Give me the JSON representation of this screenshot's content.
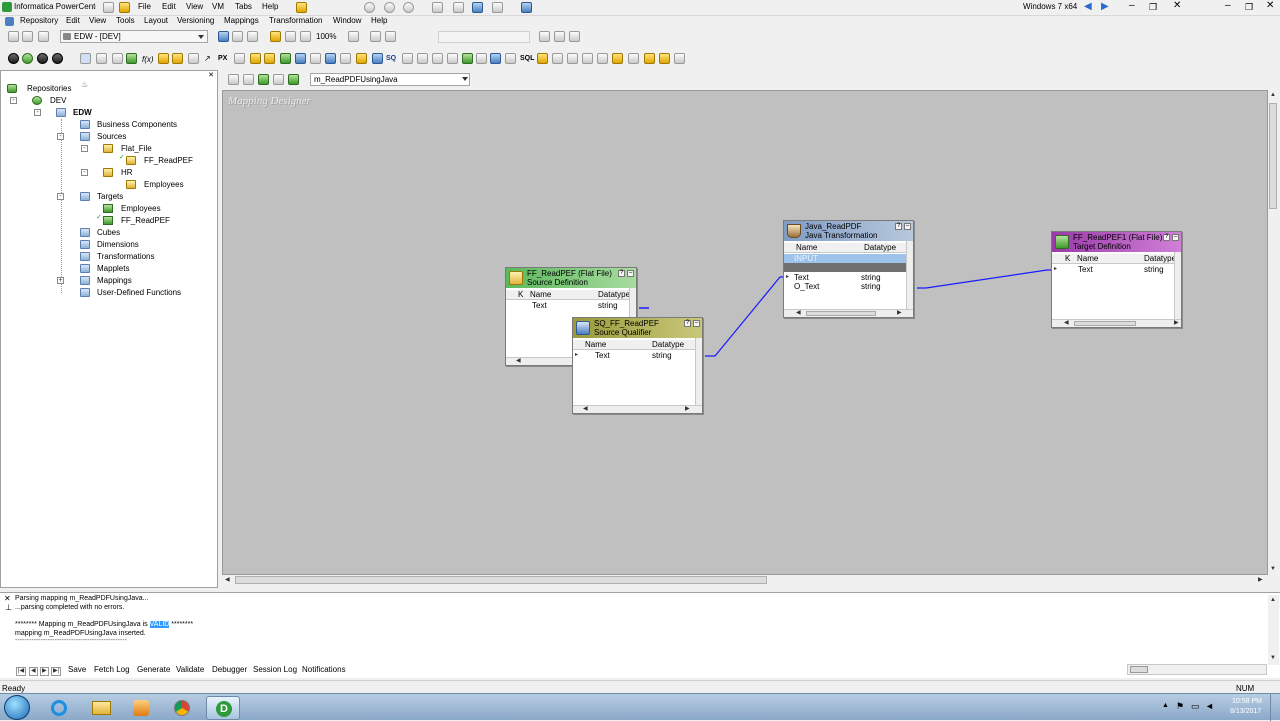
{
  "vm_bar": {
    "app_title": "Informatica PowerCenter",
    "menus": [
      "File",
      "Edit",
      "View",
      "VM",
      "Tabs",
      "Help"
    ],
    "guest_os": "Windows 7 x64"
  },
  "menubar": {
    "items": [
      "Repository",
      "Edit",
      "View",
      "Tools",
      "Layout",
      "Versioning",
      "Mappings",
      "Transformation",
      "Window",
      "Help"
    ]
  },
  "toolbar": {
    "folder_combo": "EDW - [DEV]",
    "zoom": "100%",
    "mapping_combo": "m_ReadPDFUsingJava"
  },
  "navigator": {
    "root": "Repositories",
    "repo": "DEV",
    "folder": "EDW",
    "items": {
      "business_components": "Business Components",
      "sources": "Sources",
      "flat_file": "Flat_File",
      "ff_readpef": "FF_ReadPEF",
      "hr": "HR",
      "employees_src": "Employees",
      "targets": "Targets",
      "employees_tgt": "Employees",
      "ff_readpef_tgt": "FF_ReadPEF",
      "cubes": "Cubes",
      "dimensions": "Dimensions",
      "transformations": "Transformations",
      "mapplets": "Mapplets",
      "mappings": "Mappings",
      "udf": "User-Defined Functions"
    }
  },
  "workspace": {
    "title": "Mapping Designer",
    "source": {
      "name": "FF_ReadPEF (Flat File)",
      "subtitle": "Source Definition",
      "col_k": "K",
      "col_name": "Name",
      "col_type": "Datatype",
      "rows": [
        {
          "name": "Text",
          "type": "string"
        }
      ]
    },
    "qualifier": {
      "name": "SQ_FF_ReadPEF",
      "subtitle": "Source Qualifier",
      "col_name": "Name",
      "col_type": "Datatype",
      "rows": [
        {
          "name": "Text",
          "type": "string"
        }
      ]
    },
    "java": {
      "name": "Java_ReadPDF",
      "subtitle": "Java Transformation",
      "col_name": "Name",
      "col_type": "Datatype",
      "group_input": "INPUT",
      "rows": [
        {
          "name": "Text",
          "type": "string"
        },
        {
          "name": "O_Text",
          "type": "string"
        }
      ]
    },
    "target": {
      "name": "FF_ReadPEF1 (Flat File)",
      "subtitle": "Target Definition",
      "col_k": "K",
      "col_name": "Name",
      "col_type": "Datatype",
      "rows": [
        {
          "name": "Text",
          "type": "string"
        }
      ]
    }
  },
  "output": {
    "line1": "Parsing mapping m_ReadPDFUsingJava...",
    "line2": "...parsing completed with no errors.",
    "line3_pre": "******** Mapping m_ReadPDFUsingJava is ",
    "line3_valid": "VALID",
    "line3_post": " ********",
    "line4": "mapping  m_ReadPDFUsingJava inserted.",
    "line5": "------------------------------------------------",
    "tabs": [
      "Save",
      "Fetch Log",
      "Generate",
      "Validate",
      "Debugger",
      "Session Log",
      "Notifications"
    ]
  },
  "status": {
    "text": "Ready",
    "num": "NUM"
  },
  "taskbar": {
    "time": "10:58 PM",
    "date": "8/13/2017"
  },
  "colors": {
    "canvas": "#c0c0c0",
    "source_header": "#5cb85c",
    "qualifier_header": "#a8a84a",
    "java_header": "#8fa8c8",
    "target_header": "#b04ab8",
    "link": "#1a1aff",
    "valid_highlight": "#3399ff"
  }
}
